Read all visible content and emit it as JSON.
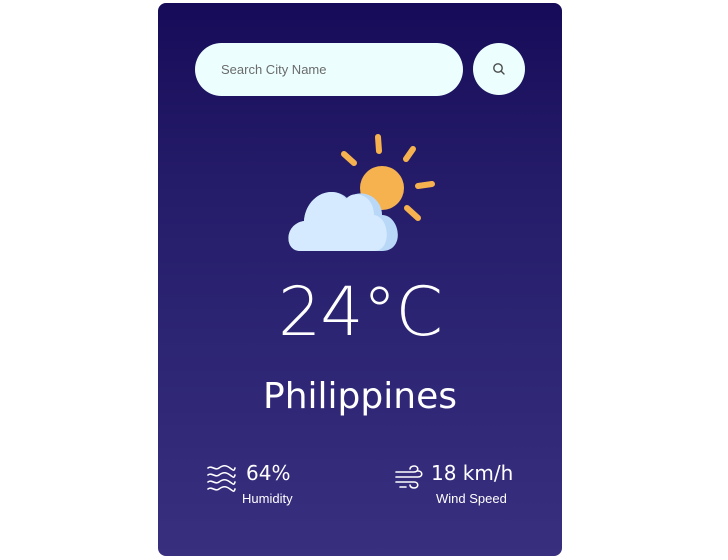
{
  "search": {
    "placeholder": "Search City Name",
    "value": "",
    "button_icon": "search-icon"
  },
  "weather": {
    "icon": "partly-cloudy-icon",
    "temperature": "24°C",
    "city": "Philippines"
  },
  "details": {
    "humidity": {
      "icon": "humidity-waves-icon",
      "value": "64%",
      "label": "Humidity"
    },
    "wind": {
      "icon": "wind-icon",
      "value": "18 km/h",
      "label": "Wind Speed"
    }
  },
  "colors": {
    "card_top": "#160b58",
    "card_bottom": "#392f7f",
    "input_bg": "#ecfffe",
    "sun": "#f6b24f",
    "cloud": "#d6eaff"
  }
}
